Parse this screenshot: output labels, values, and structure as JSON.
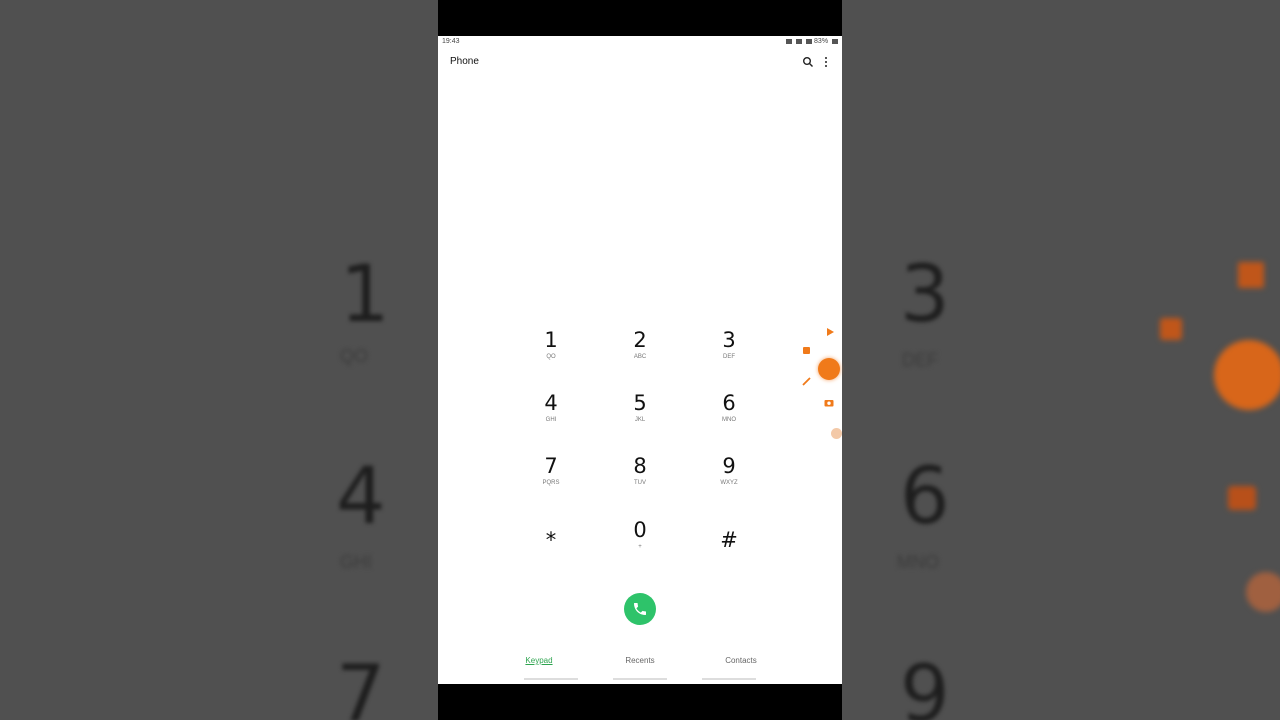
{
  "status_bar": {
    "time": "19:43",
    "battery": "83%"
  },
  "app": {
    "title": "Phone"
  },
  "keypad": {
    "keys": [
      {
        "digit": "1",
        "letters": "QO"
      },
      {
        "digit": "2",
        "letters": "ABC"
      },
      {
        "digit": "3",
        "letters": "DEF"
      },
      {
        "digit": "4",
        "letters": "GHI"
      },
      {
        "digit": "5",
        "letters": "JKL"
      },
      {
        "digit": "6",
        "letters": "MNO"
      },
      {
        "digit": "7",
        "letters": "PQRS"
      },
      {
        "digit": "8",
        "letters": "TUV"
      },
      {
        "digit": "9",
        "letters": "WXYZ"
      },
      {
        "digit": "*",
        "letters": ""
      },
      {
        "digit": "0",
        "letters": "+"
      },
      {
        "digit": "#",
        "letters": ""
      }
    ]
  },
  "tabs": {
    "keypad": "Keypad",
    "recents": "Recents",
    "contacts": "Contacts"
  },
  "colors": {
    "accent": "#2ea44f",
    "call": "#2ec36a",
    "recorder": "#f07a1a"
  },
  "background": {
    "left": [
      {
        "digit": "1",
        "letters": "QO"
      },
      {
        "digit": "4",
        "letters": "GHI"
      },
      {
        "digit": "7",
        "letters": ""
      }
    ],
    "right": [
      {
        "digit": "3",
        "letters": "DEF"
      },
      {
        "digit": "6",
        "letters": "MNO"
      },
      {
        "digit": "9",
        "letters": ""
      }
    ]
  }
}
